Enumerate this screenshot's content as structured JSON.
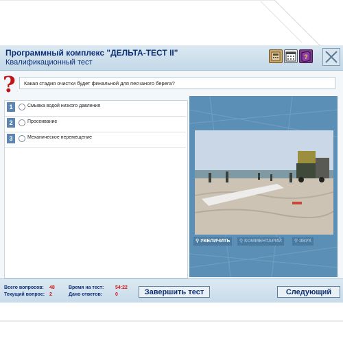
{
  "app": {
    "title": "Программный комплекс \"ДЕЛЬТА-ТЕСТ II\"",
    "subtitle": "Квалификационный тест",
    "header_icons": [
      "calculator-icon",
      "calendar-icon",
      "book-icon",
      "close-icon"
    ]
  },
  "question": {
    "text": "Какая стадия очистки будет финальной для песчаного берега?"
  },
  "answers": [
    {
      "number": "1",
      "label": "Смывка водой низкого давления"
    },
    {
      "number": "2",
      "label": "Просеивание"
    },
    {
      "number": "3",
      "label": "Механическое перемещение"
    }
  ],
  "media": {
    "tools": {
      "zoom": "УВЕЛИЧИТЬ",
      "comment": "КОММЕНТАРИЙ",
      "sound": "ЗВУК"
    }
  },
  "stats": {
    "total_label": "Всего вопросов:",
    "total_value": "48",
    "current_label": "Текущий вопрос:",
    "current_value": "2",
    "time_label": "Время на тест:",
    "time_value": "54:22",
    "answered_label": "Дано ответов:",
    "answered_value": "0"
  },
  "buttons": {
    "finish": "Завершить тест",
    "next": "Следующий"
  },
  "colors": {
    "title_blue": "#0b2f78",
    "accent_red": "#d01818",
    "media_bg": "#5c8fb5"
  }
}
